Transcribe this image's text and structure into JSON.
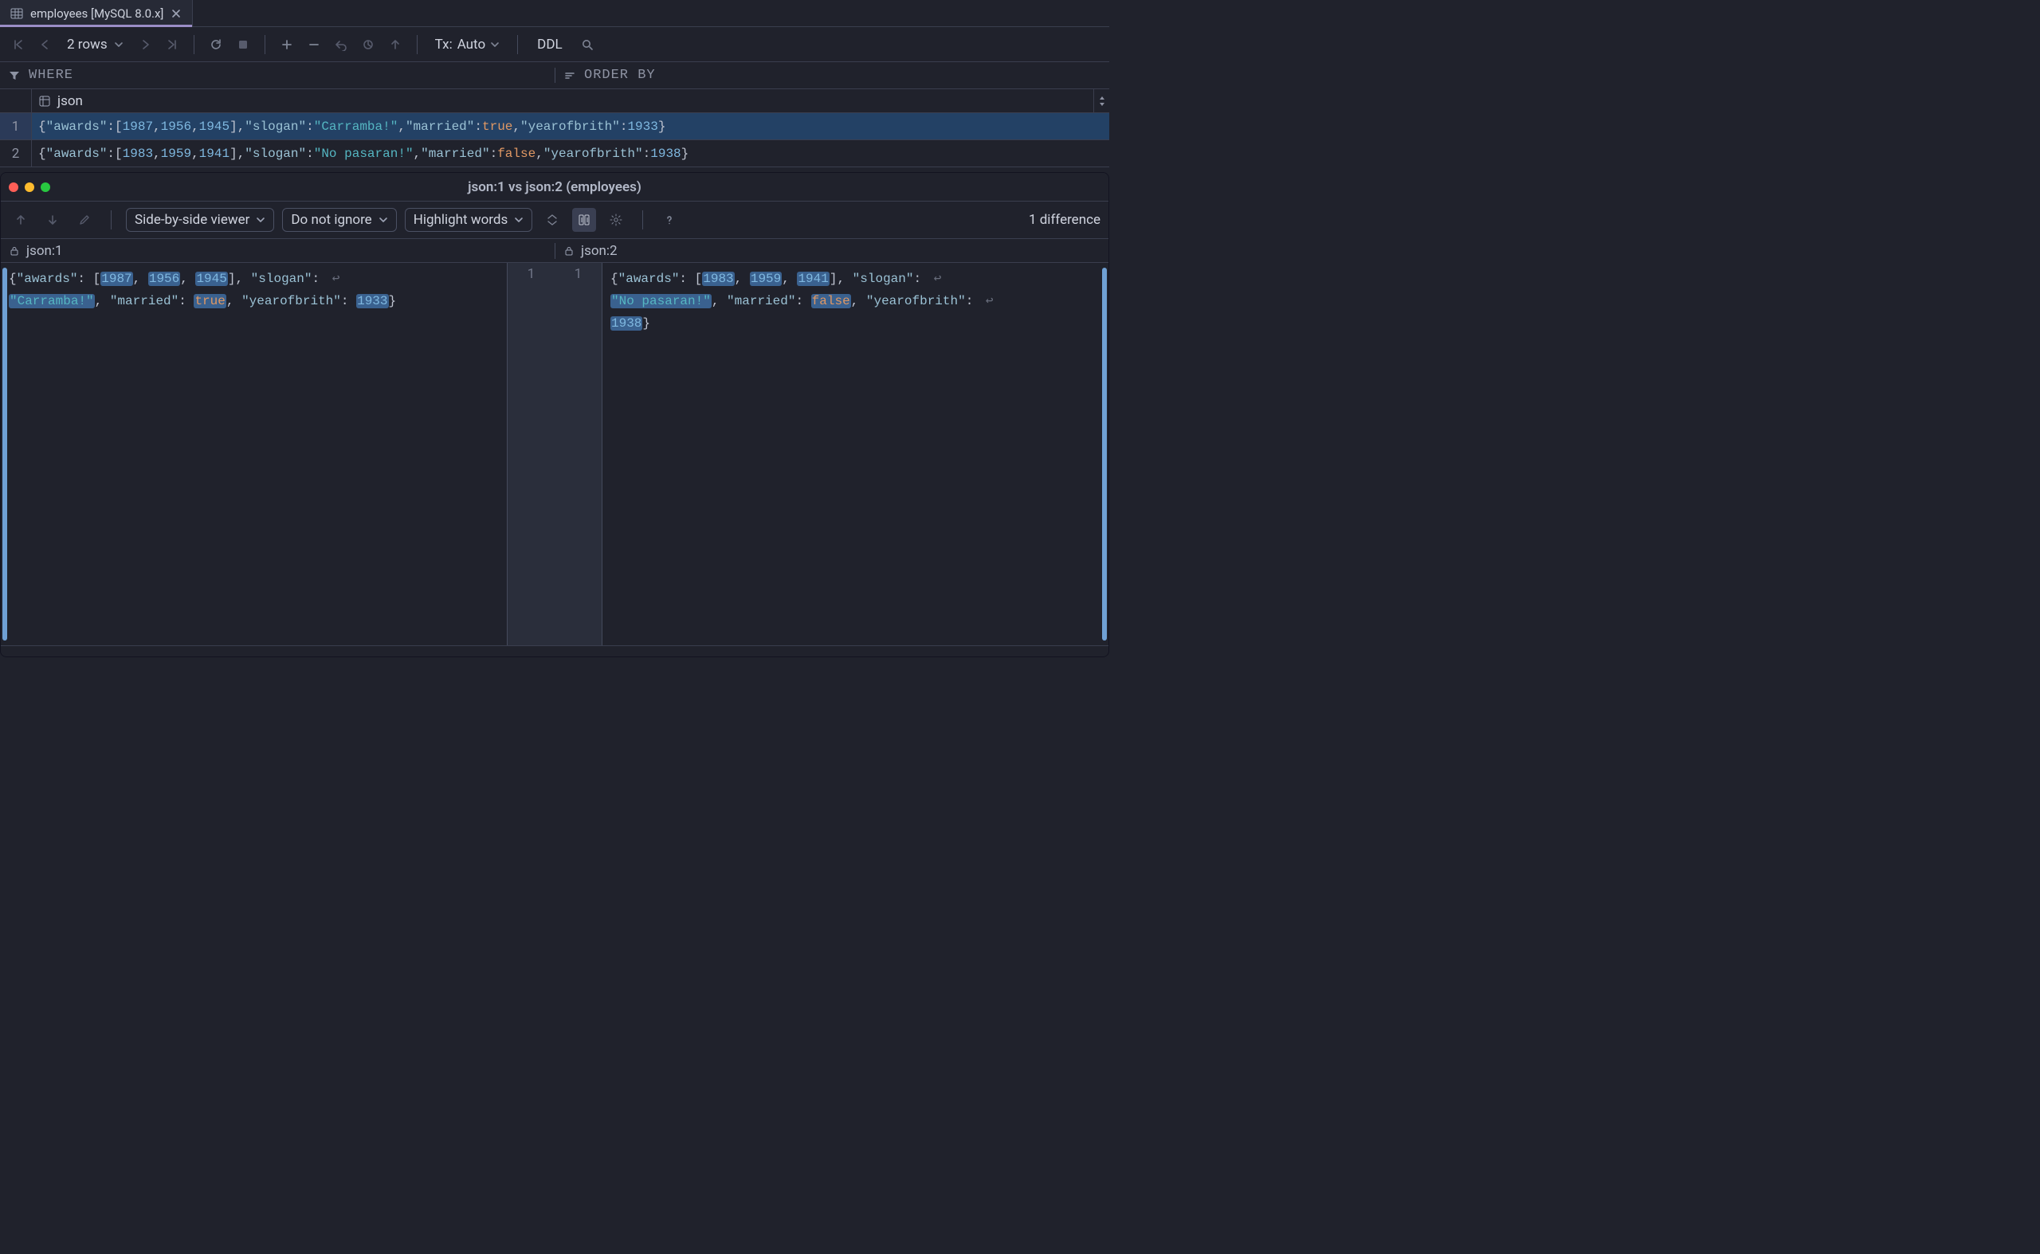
{
  "tab": {
    "title": "employees [MySQL 8.0.x]"
  },
  "toolbar": {
    "rows_label": "2 rows",
    "tx_label": "Tx:",
    "tx_value": "Auto",
    "ddl_label": "DDL"
  },
  "filter": {
    "where": "WHERE",
    "orderby": "ORDER BY"
  },
  "grid": {
    "column": "json",
    "rows": [
      {
        "num": "1",
        "json": {
          "awards": [
            1987,
            1956,
            1945
          ],
          "slogan": "Carramba!",
          "married": true,
          "yearofbrith": 1933
        }
      },
      {
        "num": "2",
        "json": {
          "awards": [
            1983,
            1959,
            1941
          ],
          "slogan": "No pasaran!",
          "married": false,
          "yearofbrith": 1938
        }
      }
    ],
    "selected_index": 0
  },
  "diff": {
    "title": "json:1 vs json:2 (employees)",
    "viewer_mode": "Side-by-side viewer",
    "ignore_mode": "Do not ignore",
    "highlight_mode": "Highlight words",
    "count_label": "1 difference",
    "left_label": "json:1",
    "right_label": "json:2",
    "gutter": {
      "left": "1",
      "right": "1"
    },
    "left_json": {
      "awards": [
        1987,
        1956,
        1945
      ],
      "slogan": "Carramba!",
      "married": true,
      "yearofbrith": 1933
    },
    "right_json": {
      "awards": [
        1983,
        1959,
        1941
      ],
      "slogan": "No pasaran!",
      "married": false,
      "yearofbrith": 1938
    }
  }
}
